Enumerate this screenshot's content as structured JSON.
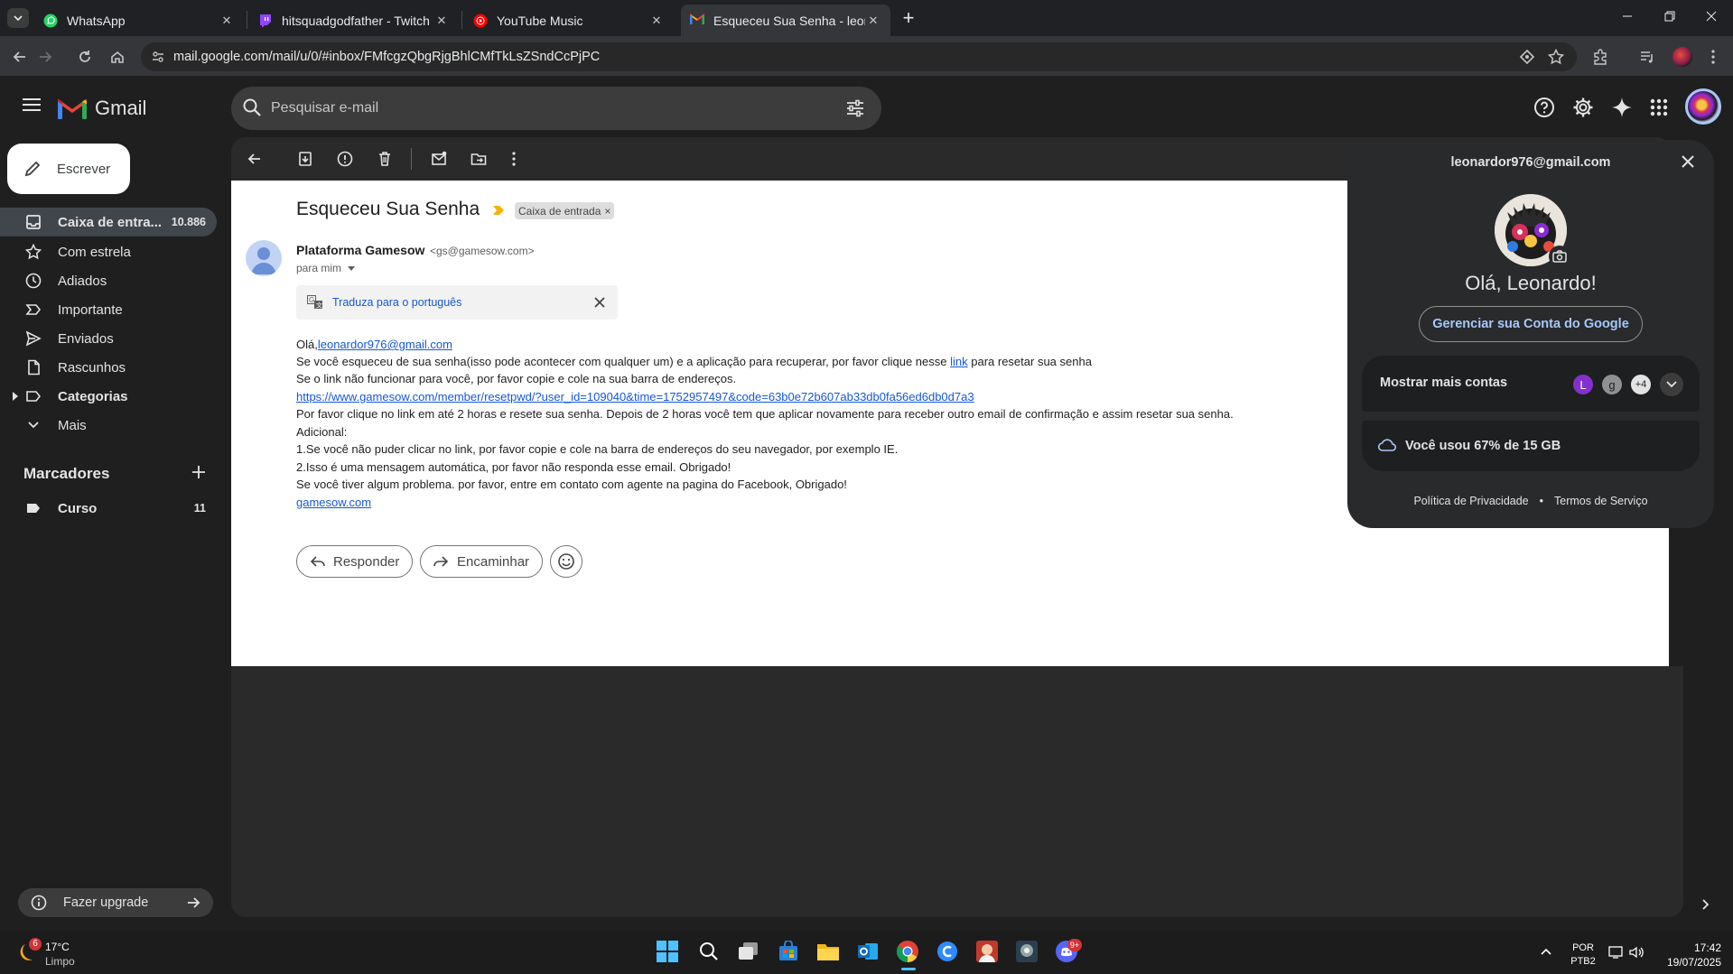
{
  "browser": {
    "tabs": [
      {
        "label": "WhatsApp"
      },
      {
        "label": "hitsquadgodfather - Twitch"
      },
      {
        "label": "YouTube Music"
      },
      {
        "label": "Esqueceu Sua Senha - leonardo"
      }
    ],
    "url": "mail.google.com/mail/u/0/#inbox/FMfcgzQbgRjgBhlCMfTkLsZSndCcPjPC"
  },
  "gmail": {
    "logo_text": "Gmail",
    "search_placeholder": "Pesquisar e-mail"
  },
  "sidebar": {
    "compose_label": "Escrever",
    "items": [
      {
        "label": "Caixa de entra...",
        "count": "10.886"
      },
      {
        "label": "Com estrela",
        "count": ""
      },
      {
        "label": "Adiados",
        "count": ""
      },
      {
        "label": "Importante",
        "count": ""
      },
      {
        "label": "Enviados",
        "count": ""
      },
      {
        "label": "Rascunhos",
        "count": ""
      },
      {
        "label": "Categorias",
        "count": ""
      },
      {
        "label": "Mais",
        "count": ""
      }
    ],
    "labels_heading": "Marcadores",
    "labels": [
      {
        "label": "Curso",
        "count": "11"
      }
    ],
    "upgrade_label": "Fazer upgrade"
  },
  "email": {
    "subject": "Esqueceu Sua Senha",
    "label_chip": "Caixa de entrada",
    "label_chip_close": "×",
    "sender_name": "Plataforma Gamesow",
    "sender_email": "<gs@gamesow.com>",
    "recipient": "para mim",
    "translate": "Traduza para o português",
    "greeting_prefix": "Olá,",
    "greeting_email": "leonardor976@gmail.com",
    "line1_a": "Se você esqueceu de sua senha(isso pode acontecer com qualquer um) e a aplicação para recuperar, por favor clique nesse ",
    "line1_link": "link",
    "line1_b": " para resetar sua senha",
    "line2": "Se o link não funcionar para você, por favor copie e cole na sua barra de endereços.",
    "reset_url": "https://www.gamesow.com/member/resetpwd/?user_id=109040&time=1752957497&code=63b0e72b607ab33db0fa56ed6db0d7a3",
    "line3": "Por favor clique no link em até 2 horas e resete sua senha. Depois de 2 horas você tem que aplicar novamente para receber outro email de confirmação e assim resetar sua senha.",
    "line4": "Adicional:",
    "line5": "1.Se você não puder clicar no link, por favor copie e cole na barra de endereços do seu navegador, por exemplo IE.",
    "line6": "2.Isso é uma mensagem automática, por favor não responda esse email. Obrigado!",
    "line7": "Se você tiver algum problema. por favor, entre em contato com agente na pagina do Facebook, Obrigado!",
    "footer_link": "gamesow.com",
    "reply_label": "Responder",
    "forward_label": "Encaminhar"
  },
  "account": {
    "email": "leonardor976@gmail.com",
    "greeting": "Olá, Leonardo!",
    "manage_label": "Gerenciar sua Conta do Google",
    "more_accounts": "Mostrar mais contas",
    "avatar_letters": [
      "L",
      "g"
    ],
    "extra_count": "+4",
    "storage": "Você usou 67% de 15 GB",
    "privacy": "Política de Privacidade",
    "dot": "•",
    "terms": "Termos de Serviço"
  },
  "taskbar": {
    "weather_temp": "17°C",
    "weather_desc": "Limpo",
    "weather_badge": "6",
    "lang_line1": "POR",
    "lang_line2": "PTB2",
    "time": "17:42",
    "date": "19/07/2025",
    "discord_badge": "9+"
  },
  "colors": {
    "gmail_red": "#ea4335",
    "link_blue": "#1558d6",
    "accent_blue": "#a8c7fa",
    "avatar_purple": "#8430ce"
  }
}
